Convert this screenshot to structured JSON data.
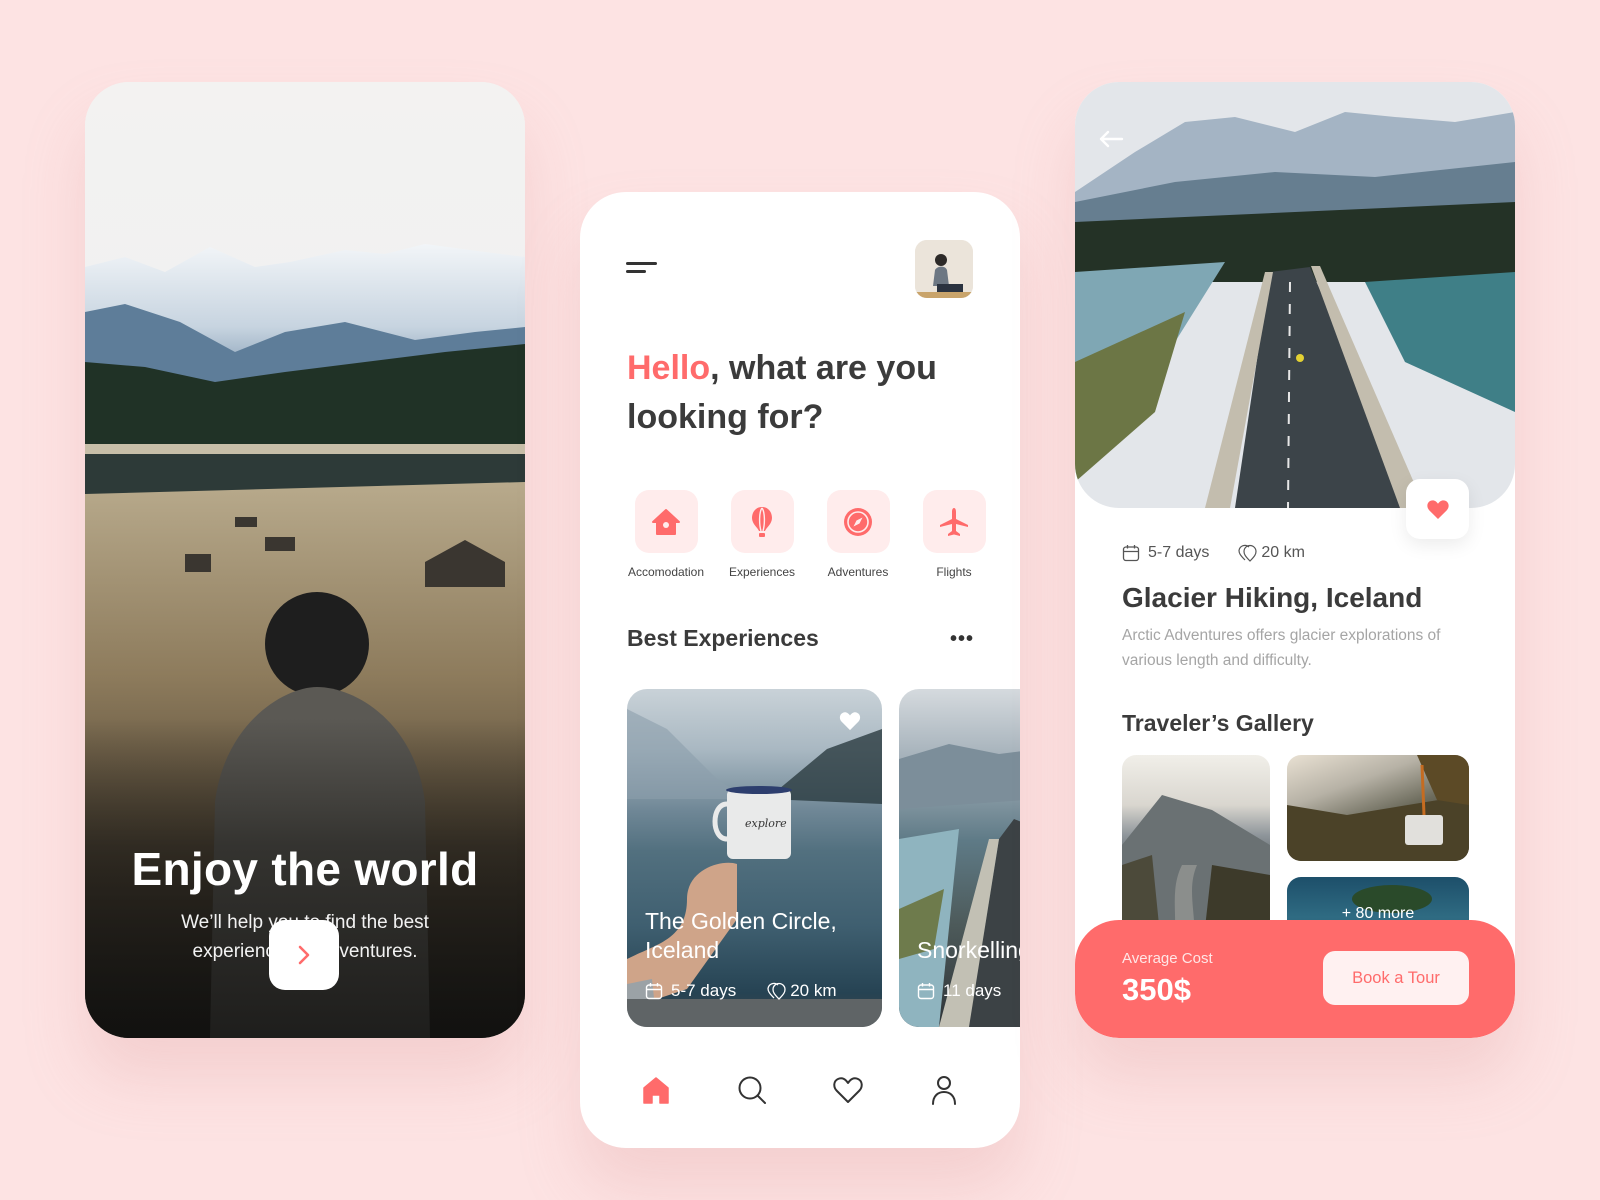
{
  "colors": {
    "accent": "#ff6b6b",
    "accent_light": "#ffecec",
    "background": "#fde3e3",
    "text_dark": "#3b3b3b",
    "text_muted": "#a5a5a5"
  },
  "splash": {
    "title": "Enjoy the world",
    "subtitle": "We’ll help you to find the best experiences & adventures.",
    "next_icon": "chevron-right-icon"
  },
  "home": {
    "menu_icon": "menu-icon",
    "greeting_highlight": "Hello",
    "greeting_rest": ", what are you looking for?",
    "categories": [
      {
        "label": "Accomodation",
        "icon": "house-icon"
      },
      {
        "label": "Experiences",
        "icon": "hot-air-balloon-icon"
      },
      {
        "label": "Adventures",
        "icon": "compass-icon"
      },
      {
        "label": "Flights",
        "icon": "airplane-icon"
      }
    ],
    "section_title": "Best Experiences",
    "more_label": "•••",
    "cards": [
      {
        "title": "The Golden Circle, Iceland",
        "duration": "5-7 days",
        "distance": "20 km",
        "favorited": true
      },
      {
        "title": "Snorkelling, Iceland",
        "duration": "11 days",
        "distance": ""
      }
    ],
    "tabbar": [
      {
        "name": "home",
        "active": true
      },
      {
        "name": "search",
        "active": false
      },
      {
        "name": "favorites",
        "active": false
      },
      {
        "name": "profile",
        "active": false
      }
    ]
  },
  "detail": {
    "duration": "5-7 days",
    "distance": "20 km",
    "title": "Glacier Hiking, Iceland",
    "description": "Arctic Adventures offers glacier explorations of various length and difficulty.",
    "gallery_title": "Traveler’s Gallery",
    "gallery_more": "+ 80 more",
    "cost_label": "Average Cost",
    "cost_value": "350$",
    "book_label": "Book a Tour"
  }
}
